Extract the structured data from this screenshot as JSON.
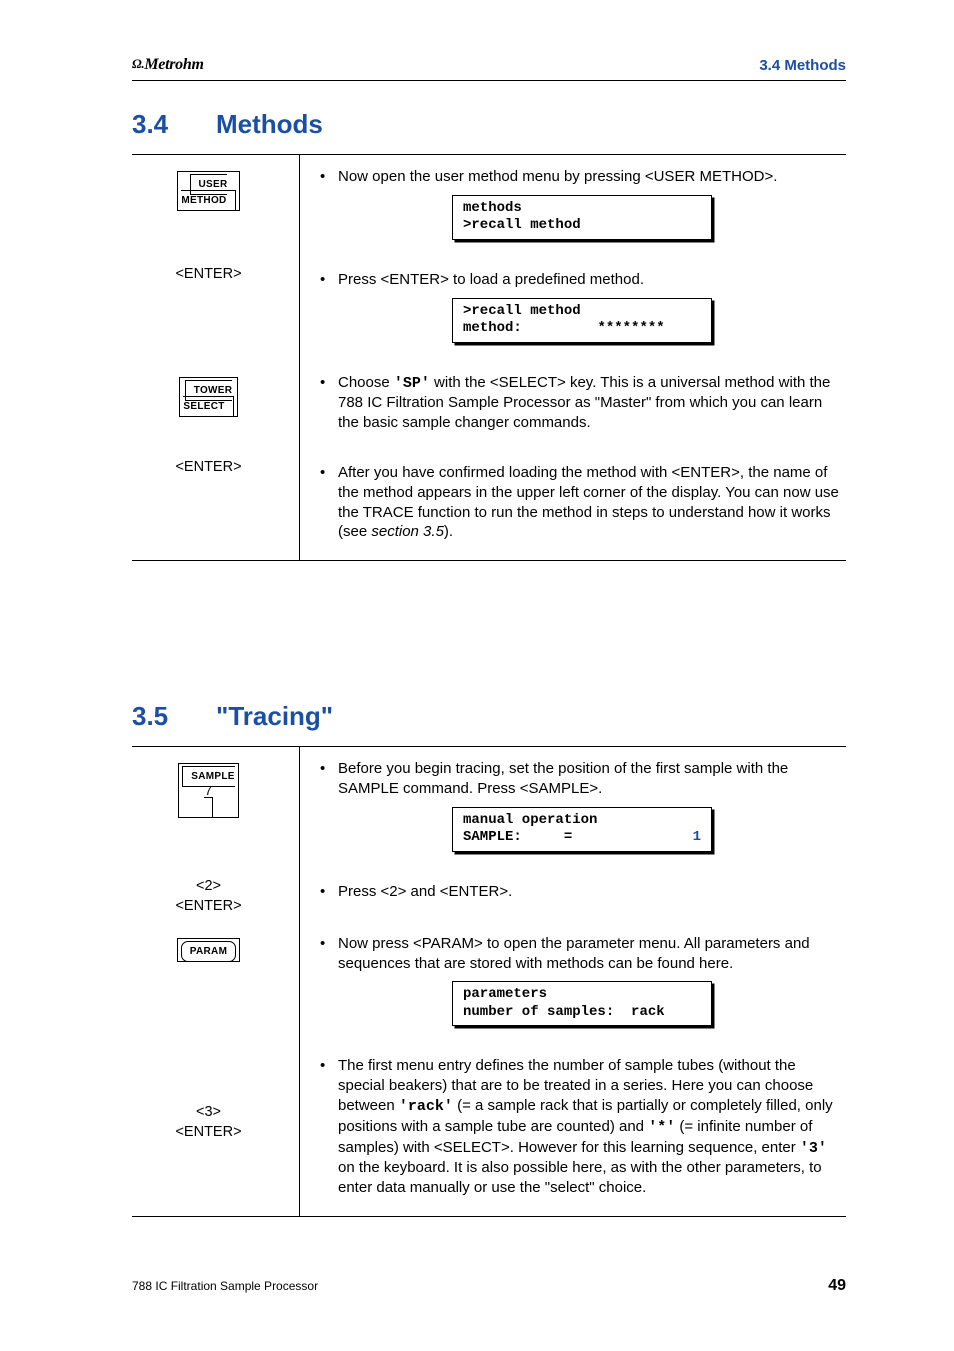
{
  "brand": "Metrohm",
  "header_right": "3.4  Methods",
  "sec34": {
    "num": "3.4",
    "title": "Methods",
    "rows": [
      {
        "key_top": "USER",
        "key_bot": "METHOD",
        "bullet": "Now open the user method menu by pressing <USER METHOD>.",
        "disp_l1": "methods",
        "disp_l2": ">recall method"
      },
      {
        "key_text": "<ENTER>",
        "bullet": "Press <ENTER> to load a predefined method.",
        "disp_l1": ">recall method",
        "disp_l2a": "method:",
        "disp_l2b": "********"
      },
      {
        "key_top": "TOWER",
        "key_bot": "SELECT",
        "bullet_pre": "Choose ",
        "code1": "'SP'",
        "bullet_post": " with the <SELECT> key. This is a universal method with the 788 IC Filtration Sample Processor as \"Master\" from which you can learn the basic sample changer commands."
      },
      {
        "key_text": "<ENTER>",
        "bullet_a": "After you have confirmed loading the method with <ENTER>, the name of the method appears in the upper left corner of the display. You can now use the TRACE function to run the method in steps to understand how it works (see ",
        "bullet_i": "section 3.5",
        "bullet_b": ")."
      }
    ]
  },
  "sec35": {
    "num": "3.5",
    "title": "\"Tracing\"",
    "row1": {
      "key_top": "SAMPLE",
      "key_sub": "7",
      "bullet": "Before you begin tracing, set the position of the first sample with the SAMPLE command. Press <SAMPLE>.",
      "disp_l1": "manual operation",
      "disp_l2a": "SAMPLE:",
      "disp_l2b": "=",
      "disp_l2c": "1"
    },
    "row2": {
      "kt1": "<2>",
      "kt2": "<ENTER>",
      "bullet": "Press <2> and <ENTER>."
    },
    "row3": {
      "key_label": "PARAM",
      "bullet": "Now press <PARAM> to open the parameter menu. All parameters and sequences that are stored with methods can be found here.",
      "disp_l1": "parameters",
      "disp_l2a": "number of samples:",
      "disp_l2b": "rack"
    },
    "row4": {
      "kt1": "<3>",
      "kt2": "<ENTER>",
      "bullet_a": "The first menu entry defines the number of sample tubes (without the special beakers) that are to be treated in a series. Here you can choose between ",
      "code1": "'rack'",
      "bullet_b": " (= a sample rack that is partially or completely filled, only positions with a sample tube are counted) and ",
      "code2": "'*'",
      "bullet_c": " (= infinite number of samples) with <SELECT>. However for this learning sequence, enter ",
      "code3": "'3'",
      "bullet_d": " on the keyboard. It is also possible here, as with the other parameters, to enter data manually or use the \"select\" choice."
    }
  },
  "footer_left": "788 IC Filtration Sample Processor",
  "footer_right": "49"
}
